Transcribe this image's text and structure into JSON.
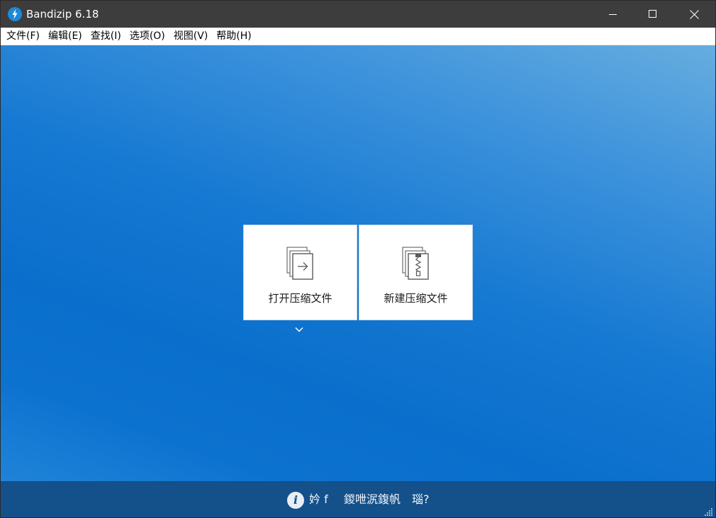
{
  "window": {
    "title": "Bandizip 6.18"
  },
  "menu": {
    "items": [
      {
        "label": "文件(F)"
      },
      {
        "label": "编辑(E)"
      },
      {
        "label": "查找(I)"
      },
      {
        "label": "选项(O)"
      },
      {
        "label": "视图(V)"
      },
      {
        "label": "帮助(H)"
      }
    ]
  },
  "tiles": {
    "open_label": "打开压缩文件",
    "new_label": "新建压缩文件"
  },
  "bottom": {
    "text1": "妗 f",
    "text2": "鍐呭泦鍑帆",
    "text3": "瑙?"
  },
  "colors": {
    "titlebar": "#3d3d3d",
    "main_gradient_top": "#66addf",
    "main_gradient_bottom": "#0a6fcc",
    "bottombar": "#14508a",
    "app_icon": "#1e88d8"
  },
  "icons": {
    "app": "bandizip-logo-icon",
    "minimize": "minimize-icon",
    "maximize": "maximize-icon",
    "close": "close-icon",
    "open_archive": "open-archive-icon",
    "new_archive": "new-archive-icon",
    "dropdown": "chevron-down-icon",
    "info": "info-icon"
  }
}
